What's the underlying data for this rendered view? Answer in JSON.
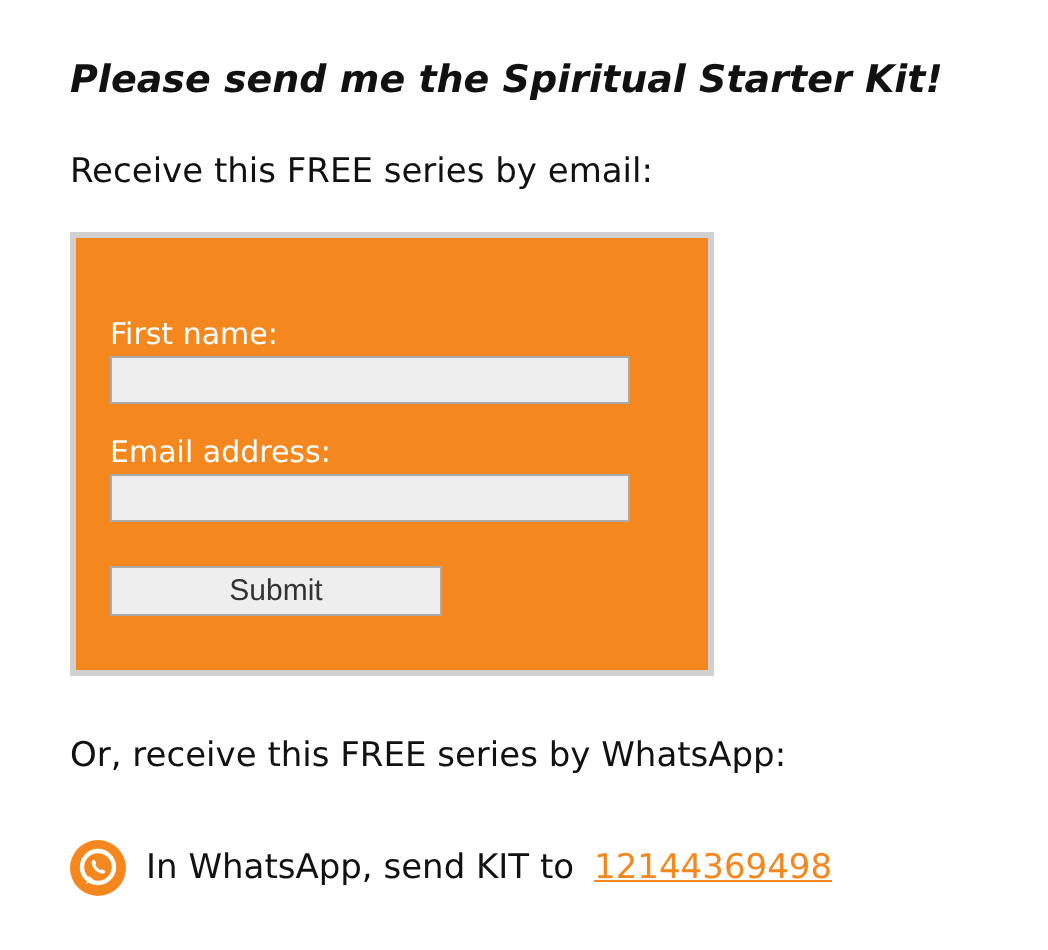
{
  "heading": "Please send me the Spiritual Starter Kit!",
  "email_intro": "Receive this FREE series by email:",
  "form": {
    "fields": [
      {
        "label": "First name:"
      },
      {
        "label": "Email address:"
      }
    ],
    "submit": "Submit"
  },
  "whatsapp_intro": "Or, receive this FREE series by WhatsApp:",
  "whatsapp": {
    "text": "In WhatsApp, send KIT to",
    "link": "12144369498"
  }
}
